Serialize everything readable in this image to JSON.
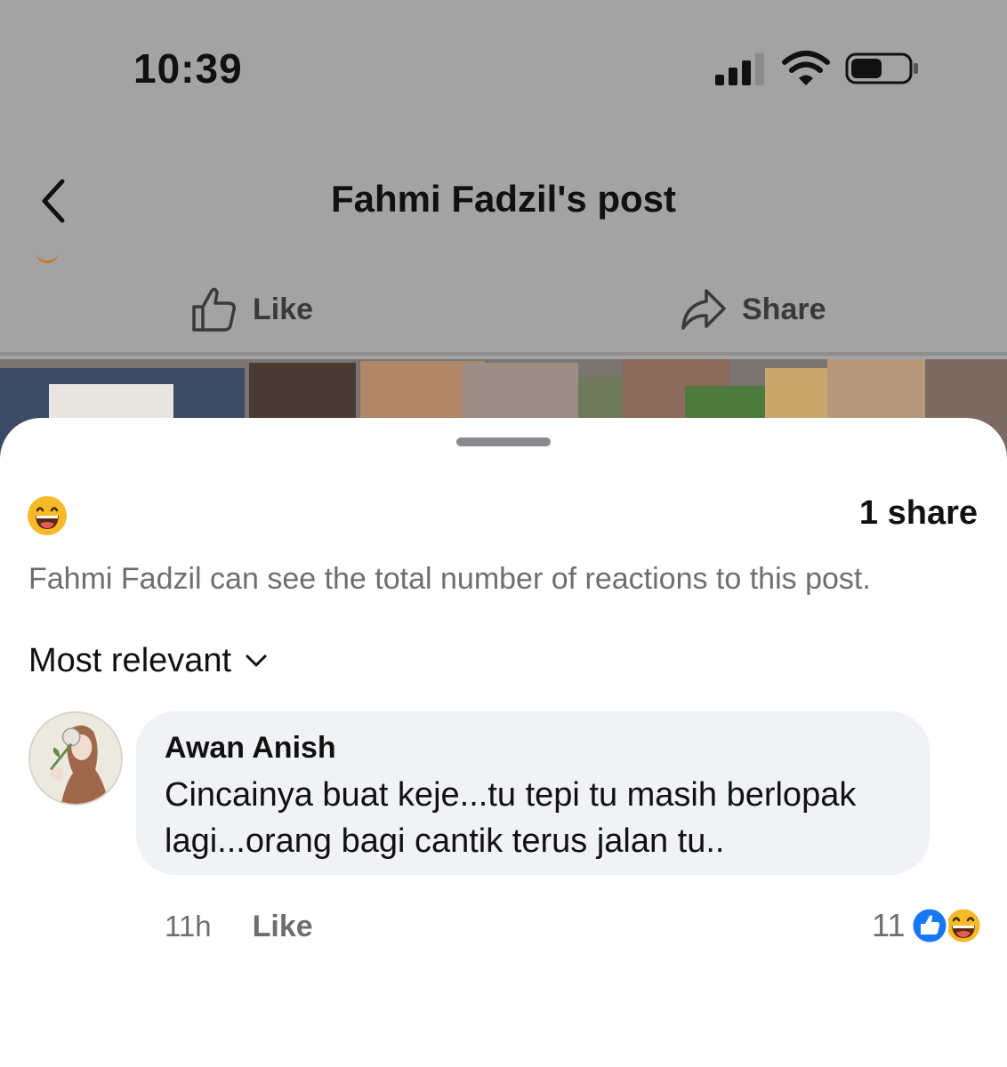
{
  "status_bar": {
    "time": "10:39"
  },
  "nav": {
    "title": "Fahmi Fadzil's post"
  },
  "post_actions": {
    "like_label": "Like",
    "share_label": "Share"
  },
  "sheet": {
    "share_count": "1 share",
    "notice": "Fahmi Fadzil can see the total number of reactions to this post.",
    "sort_label": "Most relevant"
  },
  "comments": [
    {
      "author": "Awan Anish",
      "text": "Cincainya buat keje...tu tepi tu masih berlopak lagi...orang bagi cantik terus jalan tu..",
      "time": "11h",
      "like_label": "Like",
      "reaction_count": "11",
      "reactions": [
        "like-icon",
        "haha-icon"
      ]
    }
  ],
  "colors": {
    "overlay_gray": "#a3a3a3",
    "like_blue": "#1877f2",
    "haha_yellow": "#f7b928",
    "bubble_bg": "#f0f2f5"
  }
}
